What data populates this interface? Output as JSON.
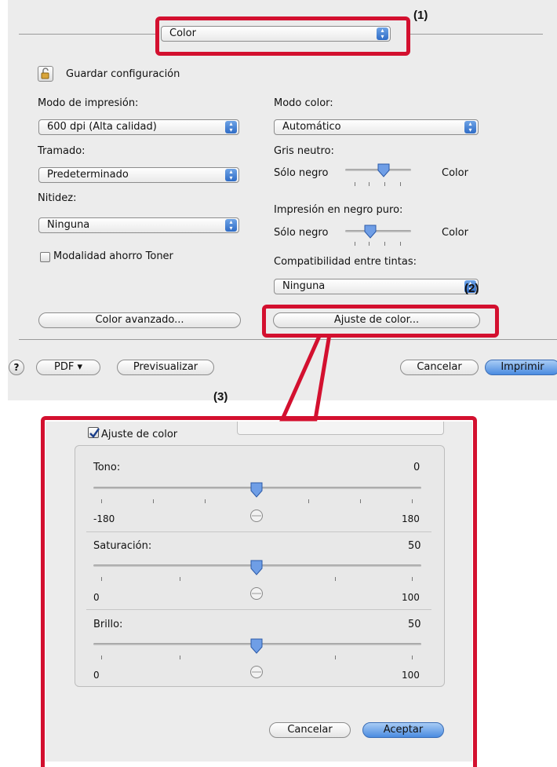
{
  "callouts": {
    "c1": "(1)",
    "c2": "(2)",
    "c3": "(3)"
  },
  "top_dialog": {
    "panel_menu": {
      "value": "Color"
    },
    "save_config_label": "Guardar configuración",
    "print_mode": {
      "label": "Modo de impresión:",
      "value": "600 dpi (Alta calidad)"
    },
    "color_mode": {
      "label": "Modo color:",
      "value": "Automático"
    },
    "screening": {
      "label": "Tramado:",
      "value": "Predeterminado"
    },
    "neutral_gray": {
      "label": "Gris neutro:",
      "left": "Sólo negro",
      "right": "Color"
    },
    "sharpness": {
      "label": "Nitidez:",
      "value": "Ninguna"
    },
    "pure_black": {
      "label": "Impresión en negro puro:",
      "left": "Sólo negro",
      "right": "Color"
    },
    "toner_save_label": "Modalidad ahorro Toner",
    "ink_compat": {
      "label": "Compatibilidad entre tintas:",
      "value": "Ninguna"
    },
    "advanced_color_button": "Color avanzado...",
    "color_adjust_button": "Ajuste de color...",
    "help_glyph": "?",
    "pdf_button": "PDF ▾",
    "preview_button": "Previsualizar",
    "cancel_button": "Cancelar",
    "print_button": "Imprimir"
  },
  "adjust_dialog": {
    "checkbox_label": "Ajuste de color",
    "checked": true,
    "sliders": [
      {
        "label": "Tono:",
        "value": "0",
        "min": "-180",
        "max": "180"
      },
      {
        "label": "Saturación:",
        "value": "50",
        "min": "0",
        "max": "100"
      },
      {
        "label": "Brillo:",
        "value": "50",
        "min": "0",
        "max": "100"
      }
    ],
    "cancel_button": "Cancelar",
    "accept_button": "Aceptar"
  },
  "colors": {
    "callout_red": "#d3102f",
    "accent_blue": "#3a78d8"
  }
}
